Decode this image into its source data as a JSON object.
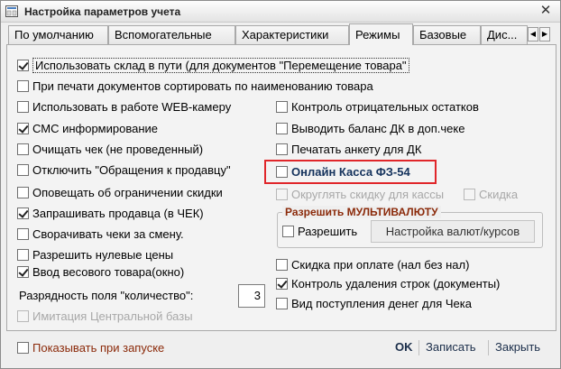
{
  "window": {
    "title": "Настройка параметров учета"
  },
  "tabs": [
    {
      "label": "По умолчанию"
    },
    {
      "label": "Вспомогательные"
    },
    {
      "label": "Характеристики"
    },
    {
      "label": "Режимы"
    },
    {
      "label": "Базовые"
    },
    {
      "label": "Дис..."
    }
  ],
  "left_options": [
    {
      "label": "Использовать склад в пути (для документов \"Перемещение товара\"",
      "checked": true
    },
    {
      "label": "При печати документов сортировать по наименованию товара",
      "checked": false
    },
    {
      "label": "Использовать в работе WEB-камеру",
      "checked": false
    },
    {
      "label": "СМС информирование",
      "checked": true
    },
    {
      "label": "Очищать чек (не проведенный)",
      "checked": false
    },
    {
      "label": "Отключить \"Обращения к продавцу\"",
      "checked": false
    },
    {
      "label": "Оповещать об ограничении скидки",
      "checked": false
    },
    {
      "label": "Запрашивать продавца (в ЧЕК)",
      "checked": true
    },
    {
      "label": "Сворачивать чеки за смену.",
      "checked": false
    },
    {
      "label": "Разрешить нулевые цены",
      "checked": false
    },
    {
      "label": "Ввод весового товара(окно)",
      "checked": true
    }
  ],
  "right_options": [
    {
      "label": "Контроль отрицательных остатков",
      "checked": false
    },
    {
      "label": "Выводить баланс ДК в доп.чеке",
      "checked": false
    },
    {
      "label": "Печатать анкету для ДК",
      "checked": false
    },
    {
      "label": "Онлайн Касса ФЗ-54",
      "checked": false
    }
  ],
  "rounding": {
    "label": "Округлять скидку для кассы",
    "checked": false
  },
  "discount": {
    "label": "Скидка",
    "checked": false
  },
  "multicurrency": {
    "group_title": "Разрешить МУЛЬТИВАЛЮТУ",
    "allow_label": "Разрешить",
    "allow_checked": false,
    "settings_button": "Настройка валют/курсов"
  },
  "right_lower_options": [
    {
      "label": "Скидка при оплате (нал без нал)",
      "checked": false
    },
    {
      "label": "Контроль удаления строк (документы)",
      "checked": true
    },
    {
      "label": "Вид поступления денег для Чека",
      "checked": false
    }
  ],
  "quantity_digits": {
    "label": "Разрядность поля \"количество\":",
    "value": "3"
  },
  "central_db": {
    "label": "Имитация Центральной базы",
    "checked": false
  },
  "show_on_start": {
    "label": "Показывать при запуске",
    "checked": false
  },
  "footer": {
    "ok": "OK",
    "save": "Записать",
    "close": "Закрыть"
  }
}
